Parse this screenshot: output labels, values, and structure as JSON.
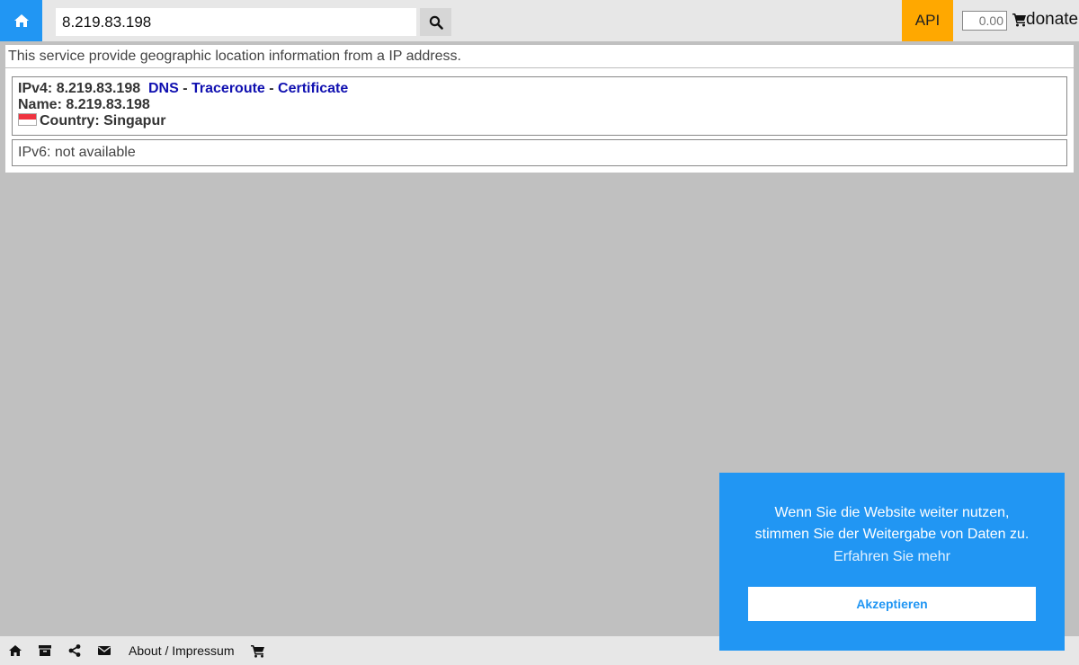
{
  "header": {
    "search_value": "8.219.83.198",
    "api_label": "API",
    "donate_placeholder": "0.00",
    "donate_label": "donate"
  },
  "intro": "This service provide geographic location information from a IP address.",
  "result": {
    "ipv4_prefix": "IPv4: 8.219.83.198",
    "links": {
      "dns": "DNS",
      "traceroute": "Traceroute",
      "certificate": "Certificate",
      "separator": " - "
    },
    "name_line": "Name: 8.219.83.198",
    "country_line": "Country: Singapur",
    "ipv6_line": "IPv6: not available"
  },
  "footer": {
    "about_label": "About / Impressum"
  },
  "cookie": {
    "line1": "Wenn Sie die Website weiter nutzen,",
    "line2": "stimmen Sie der Weitergabe von Daten zu.",
    "more_link": "Erfahren Sie mehr",
    "accept_label": "Akzeptieren"
  },
  "colors": {
    "accent_blue": "#2196f3",
    "api_orange": "#ffa800",
    "link_blue": "#1010b0",
    "background_gray": "#c0c0c0"
  }
}
